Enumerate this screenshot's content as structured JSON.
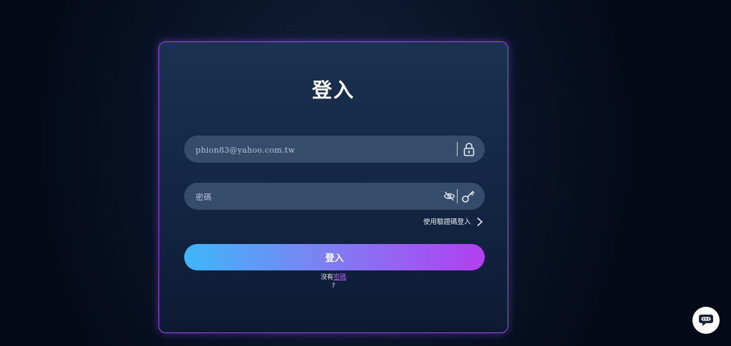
{
  "login": {
    "title": "登入",
    "email_value": "phion83@yahoo.com.tw",
    "password_placeholder": "密碼",
    "otp_link": "使用驗證碼登入",
    "submit_label": "登入",
    "no_account_prefix": "沒有",
    "no_account_link": "密碼",
    "question_mark": "?"
  },
  "icons": {
    "email_field": "lock-icon",
    "password_toggle": "eye-slash-icon",
    "password_field": "key-icon",
    "otp_link": "chevron-right-icon",
    "chat": "chat-bubble-icon"
  },
  "colors": {
    "card_border": "#9a4fe0",
    "field_bg": "#354d6b",
    "gradient_start": "#3fb6fb",
    "gradient_end": "#b23ff0",
    "link": "#b45ef5"
  }
}
